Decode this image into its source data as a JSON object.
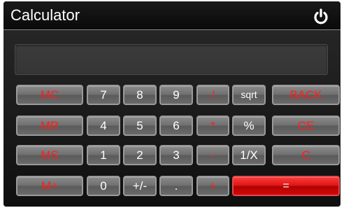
{
  "window": {
    "title": "Calculator",
    "power_icon": "power-icon"
  },
  "display": {
    "value": ""
  },
  "keys": {
    "mc": "MC",
    "mr": "MR",
    "ms": "MS",
    "mplus": "M+",
    "k7": "7",
    "k8": "8",
    "k9": "9",
    "k4": "4",
    "k5": "5",
    "k6": "6",
    "k1": "1",
    "k2": "2",
    "k3": "3",
    "k0": "0",
    "plusminus": "+/-",
    "dot": ".",
    "divide": "/",
    "multiply": "*",
    "minus": "-",
    "plus": "+",
    "sqrt": "sqrt",
    "percent": "%",
    "reciprocal": "1/X",
    "back": "BACK",
    "ce": "CE",
    "c": "C",
    "equals": "="
  },
  "colors": {
    "accent_red": "#ff1e1e",
    "equals_bg": "#d91414",
    "button_gray": "#6e6e6e",
    "window_bg": "#000000"
  }
}
